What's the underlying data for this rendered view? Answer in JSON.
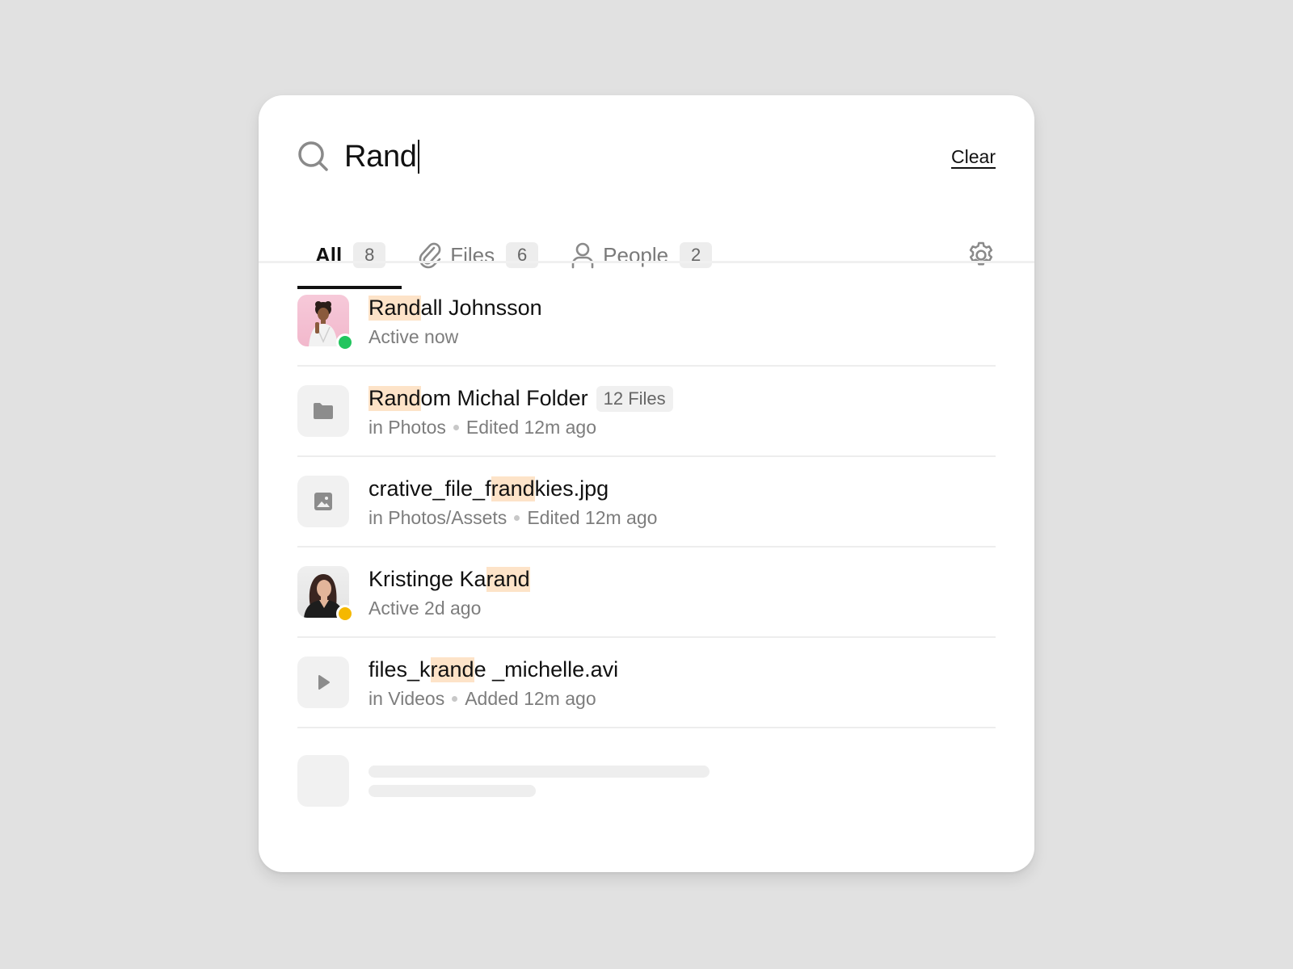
{
  "search": {
    "query": "Rand",
    "clear_label": "Clear"
  },
  "tabs": [
    {
      "label": "All",
      "count": "8",
      "icon": "none",
      "active": true
    },
    {
      "label": "Files",
      "count": "6",
      "icon": "paperclip-icon",
      "active": false
    },
    {
      "label": "People",
      "count": "2",
      "icon": "person-icon",
      "active": false
    }
  ],
  "results": [
    {
      "kind": "person",
      "title_highlight": "Rand",
      "title_rest": "all Johnsson",
      "subtitle": "Active now",
      "status_color": "#22c55e"
    },
    {
      "kind": "folder",
      "title_highlight": "Rand",
      "title_rest": "om Michal Folder",
      "badge": "12 Files",
      "location": "in Photos",
      "meta": "Edited 12m ago",
      "icon": "folder-icon"
    },
    {
      "kind": "image",
      "title_pre": "crative_file_f",
      "title_highlight": "rand",
      "title_rest": "kies.jpg",
      "location": "in Photos/Assets",
      "meta": "Edited 12m ago",
      "icon": "image-icon"
    },
    {
      "kind": "person",
      "title_pre": "Kristinge Ka",
      "title_highlight": "rand",
      "subtitle": "Active 2d ago",
      "status_color": "#f5b800"
    },
    {
      "kind": "video",
      "title_pre": "files_k",
      "title_highlight": "rand",
      "title_rest": "e _michelle.avi",
      "location": "in Videos",
      "meta": "Added 12m ago",
      "icon": "play-icon"
    }
  ],
  "colors": {
    "highlight": "#fde3c8",
    "online": "#22c55e",
    "away": "#f5b800",
    "background": "#e1e1e1"
  }
}
